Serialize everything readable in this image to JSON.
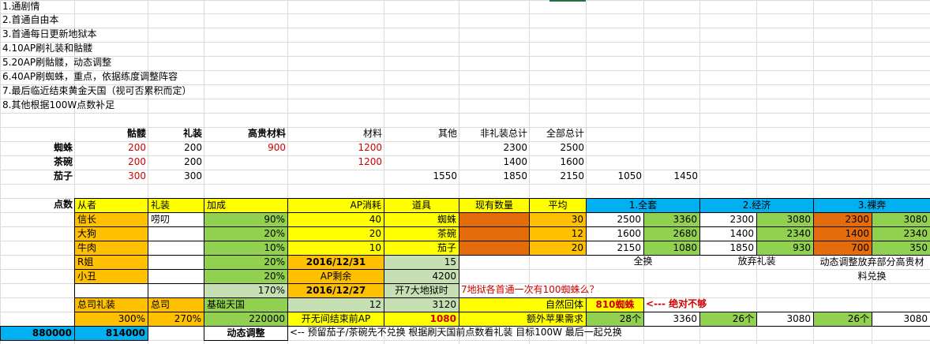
{
  "notes": [
    "1.通剧情",
    "2.首通自由本",
    "3.首通每日更新地狱本",
    "4.10AP刷礼装和骷髅",
    "5.20AP刷骷髅，动态调整",
    "6.40AP刷蜘蛛，重点，依据练度调整阵容",
    "7.最后临近结束黄金天国（视可否累积而定）",
    "8.其他根据100W点数补足"
  ],
  "cost_table": {
    "headers": [
      "骷髅",
      "礼装",
      "高贵材料",
      "材料",
      "其他",
      "非礼装总计",
      "全部总计"
    ],
    "rows": [
      {
        "label": "蜘蛛",
        "values": [
          "200",
          "200",
          "900",
          "1200",
          "",
          "2300",
          "2500"
        ],
        "extra": [
          "",
          ""
        ]
      },
      {
        "label": "茶碗",
        "values": [
          "200",
          "200",
          "",
          "1200",
          "",
          "1400",
          "1600"
        ],
        "extra": [
          "",
          ""
        ]
      },
      {
        "label": "茄子",
        "values": [
          "300",
          "300",
          "",
          "",
          "1550",
          "1850",
          "2150"
        ],
        "extra": [
          "1050",
          "1450"
        ]
      }
    ]
  },
  "points_label": "点数",
  "servant_table": {
    "headers": [
      "从者",
      "礼装",
      "加成"
    ],
    "rows": [
      [
        "信长",
        "唠叨",
        "90%"
      ],
      [
        "大狗",
        "",
        "20%"
      ],
      [
        "牛肉",
        "",
        "10%"
      ],
      [
        "R姐",
        "",
        "20%"
      ],
      [
        "小丑",
        "",
        "20%"
      ],
      [
        "",
        "",
        "170%"
      ]
    ]
  },
  "ap_table": {
    "headers": [
      "AP消耗",
      "道具",
      "现有数量",
      "平均"
    ],
    "rows": [
      [
        "40",
        "蜘蛛",
        "",
        "30"
      ],
      [
        "20",
        "茶碗",
        "",
        "12"
      ],
      [
        "10",
        "茄子",
        "",
        "20"
      ]
    ],
    "date1": "2016/12/31",
    "date1_value": "15",
    "ap_left_label": "AP剩余",
    "ap_left_value": "4200",
    "date2": "2016/12/27",
    "date2_note": "开7大地狱时",
    "hell_note": "7地狱各首通一次有100蜘蛛么？"
  },
  "plans": {
    "headers": [
      "1.全套",
      "2.经济",
      "3.裸奔"
    ],
    "rows": [
      [
        "2500",
        "3360",
        "2300",
        "3080",
        "2300",
        "3080"
      ],
      [
        "1600",
        "2680",
        "1400",
        "2340",
        "1400",
        "2340"
      ],
      [
        "2150",
        "1080",
        "1850",
        "930",
        "700",
        "350"
      ]
    ],
    "captions": [
      "全换",
      "放弃礼装",
      "动态调整放弃部分高贵材料兑换"
    ]
  },
  "bottom": {
    "row1": [
      "总司礼装",
      "总司",
      "基础天国",
      "12",
      "3120",
      "自然回体",
      "810蜘蛛",
      "<---  绝对不够"
    ],
    "row2": [
      "300%",
      "270%",
      "220000",
      "开无间结束前AP",
      "1080",
      "额外苹果需求",
      "28个",
      "3360",
      "26个",
      "3080",
      "26个",
      "3080"
    ],
    "row3": [
      "880000",
      "814000",
      "动态调整",
      "<-- 预留茄子/茶碗先不兑换 根据刷天国前点数看礼装 目标100W 最后一起兑换"
    ]
  }
}
